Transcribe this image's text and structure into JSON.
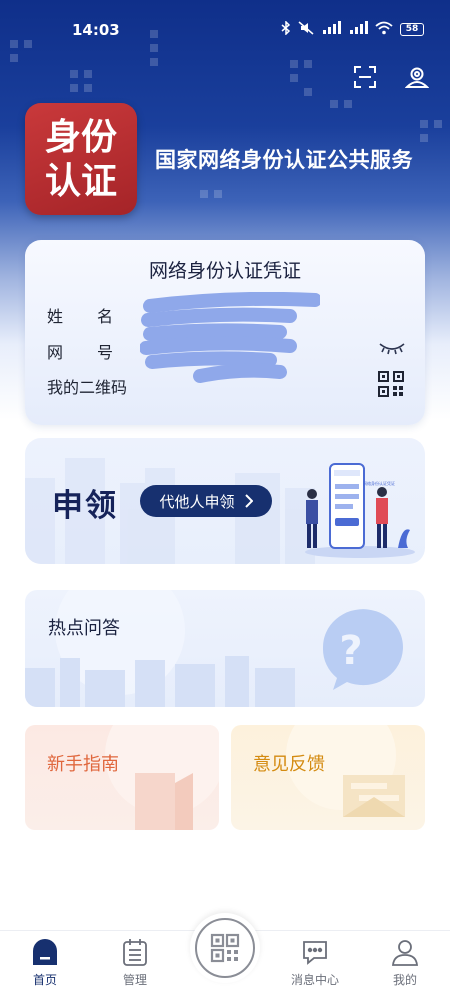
{
  "status_bar": {
    "time": "14:03",
    "battery": "58",
    "icons": [
      "bluetooth-icon",
      "mute-icon",
      "signal-hd-icon",
      "signal-hd-icon",
      "wifi-icon",
      "battery-icon"
    ]
  },
  "header": {
    "logo_line1": "身份",
    "logo_line2": "认证",
    "title": "国家网络身份认证公共服务",
    "actions": [
      "scan-icon",
      "user-settings-icon"
    ]
  },
  "credential": {
    "title": "网络身份认证凭证",
    "name_label": "姓名",
    "number_label": "网号",
    "qr_label": "我的二维码"
  },
  "apply": {
    "title": "申领",
    "button": "代他人申领",
    "illustration_text": "网络身份认证凭证"
  },
  "faq": {
    "title": "热点问答"
  },
  "guide": {
    "title": "新手指南"
  },
  "feedback": {
    "title": "意见反馈"
  },
  "bottom_nav": {
    "items": [
      {
        "label": "首页",
        "icon": "home-icon"
      },
      {
        "label": "管理",
        "icon": "manage-icon"
      },
      {
        "label": "",
        "icon": "qr-code-icon"
      },
      {
        "label": "消息中心",
        "icon": "message-icon"
      },
      {
        "label": "我的",
        "icon": "profile-icon"
      }
    ]
  },
  "colors": {
    "brand_navy": "#17306f",
    "logo_red": "#b72e31",
    "guide_orange": "#e0673d",
    "feedback_amber": "#d48b11",
    "redaction_blue": "#8fa8ea"
  }
}
